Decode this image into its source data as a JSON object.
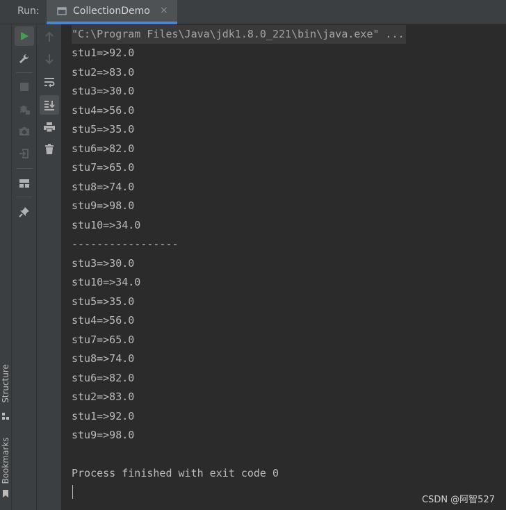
{
  "header": {
    "run_label": "Run:",
    "tab_title": "CollectionDemo",
    "tab_close": "×"
  },
  "side_tabs": {
    "structure": "Structure",
    "bookmarks": "Bookmarks"
  },
  "console": {
    "command": "\"C:\\Program Files\\Java\\jdk1.8.0_221\\bin\\java.exe\" ...",
    "lines": [
      "stu1=>92.0",
      "stu2=>83.0",
      "stu3=>30.0",
      "stu4=>56.0",
      "stu5=>35.0",
      "stu6=>82.0",
      "stu7=>65.0",
      "stu8=>74.0",
      "stu9=>98.0",
      "stu10=>34.0",
      "-----------------",
      "stu3=>30.0",
      "stu10=>34.0",
      "stu5=>35.0",
      "stu4=>56.0",
      "stu7=>65.0",
      "stu8=>74.0",
      "stu6=>82.0",
      "stu2=>83.0",
      "stu1=>92.0",
      "stu9=>98.0",
      "",
      "Process finished with exit code 0"
    ]
  },
  "watermark": "CSDN @阿智527",
  "colors": {
    "run_green": "#499c54",
    "accent_blue": "#4a88c7",
    "background": "#2b2b2b",
    "panel": "#3c3f41"
  },
  "icons": {
    "col1": [
      "run-icon",
      "wrench-icon",
      "stop-icon",
      "debug-bug-icon",
      "camera-icon",
      "exit-icon",
      "layout-icon",
      "pin-icon"
    ],
    "col2": [
      "arrow-up-icon",
      "arrow-down-icon",
      "soft-wrap-icon",
      "scroll-to-end-icon",
      "print-icon",
      "trash-icon"
    ]
  }
}
